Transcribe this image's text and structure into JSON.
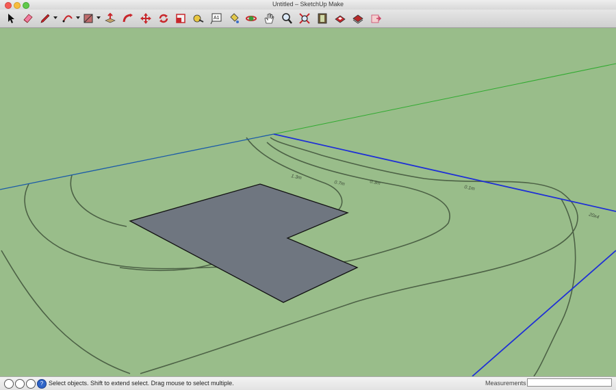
{
  "window": {
    "title": "Untitled – SketchUp Make"
  },
  "toolbar": {
    "tools": [
      {
        "id": "select",
        "icon": "arrow-cursor-icon"
      },
      {
        "id": "eraser",
        "icon": "eraser-icon"
      },
      {
        "id": "line",
        "icon": "pencil-icon"
      },
      {
        "id": "arc",
        "icon": "arc-icon"
      },
      {
        "id": "rectangle",
        "icon": "rectangle-icon"
      },
      {
        "id": "push-pull",
        "icon": "push-pull-icon"
      },
      {
        "id": "follow-me",
        "icon": "follow-me-icon"
      },
      {
        "id": "move",
        "icon": "move-icon"
      },
      {
        "id": "rotate",
        "icon": "rotate-icon"
      },
      {
        "id": "scale",
        "icon": "scale-icon"
      },
      {
        "id": "tape-measure",
        "icon": "tape-measure-icon"
      },
      {
        "id": "text",
        "icon": "text-icon",
        "label": "A1"
      },
      {
        "id": "paint-bucket",
        "icon": "paint-bucket-icon"
      },
      {
        "id": "orbit",
        "icon": "orbit-icon"
      },
      {
        "id": "pan",
        "icon": "pan-hand-icon"
      },
      {
        "id": "zoom",
        "icon": "magnifier-icon"
      },
      {
        "id": "zoom-extents",
        "icon": "zoom-extents-icon"
      },
      {
        "id": "warehouse",
        "icon": "warehouse-icon"
      },
      {
        "id": "share-model",
        "icon": "share-model-icon"
      },
      {
        "id": "extension-warehouse",
        "icon": "extension-warehouse-icon"
      },
      {
        "id": "send-to-layout",
        "icon": "send-to-layout-icon"
      }
    ]
  },
  "viewport": {
    "background_color": "#99bd8a",
    "contour_labels": [
      "1.3m",
      "0.7m",
      "0.3m",
      "0.1m",
      "20x4"
    ]
  },
  "statusbar": {
    "message": "Select objects. Shift to extend select. Drag mouse to select multiple.",
    "measurements_label": "Measurements",
    "measurements_value": ""
  }
}
